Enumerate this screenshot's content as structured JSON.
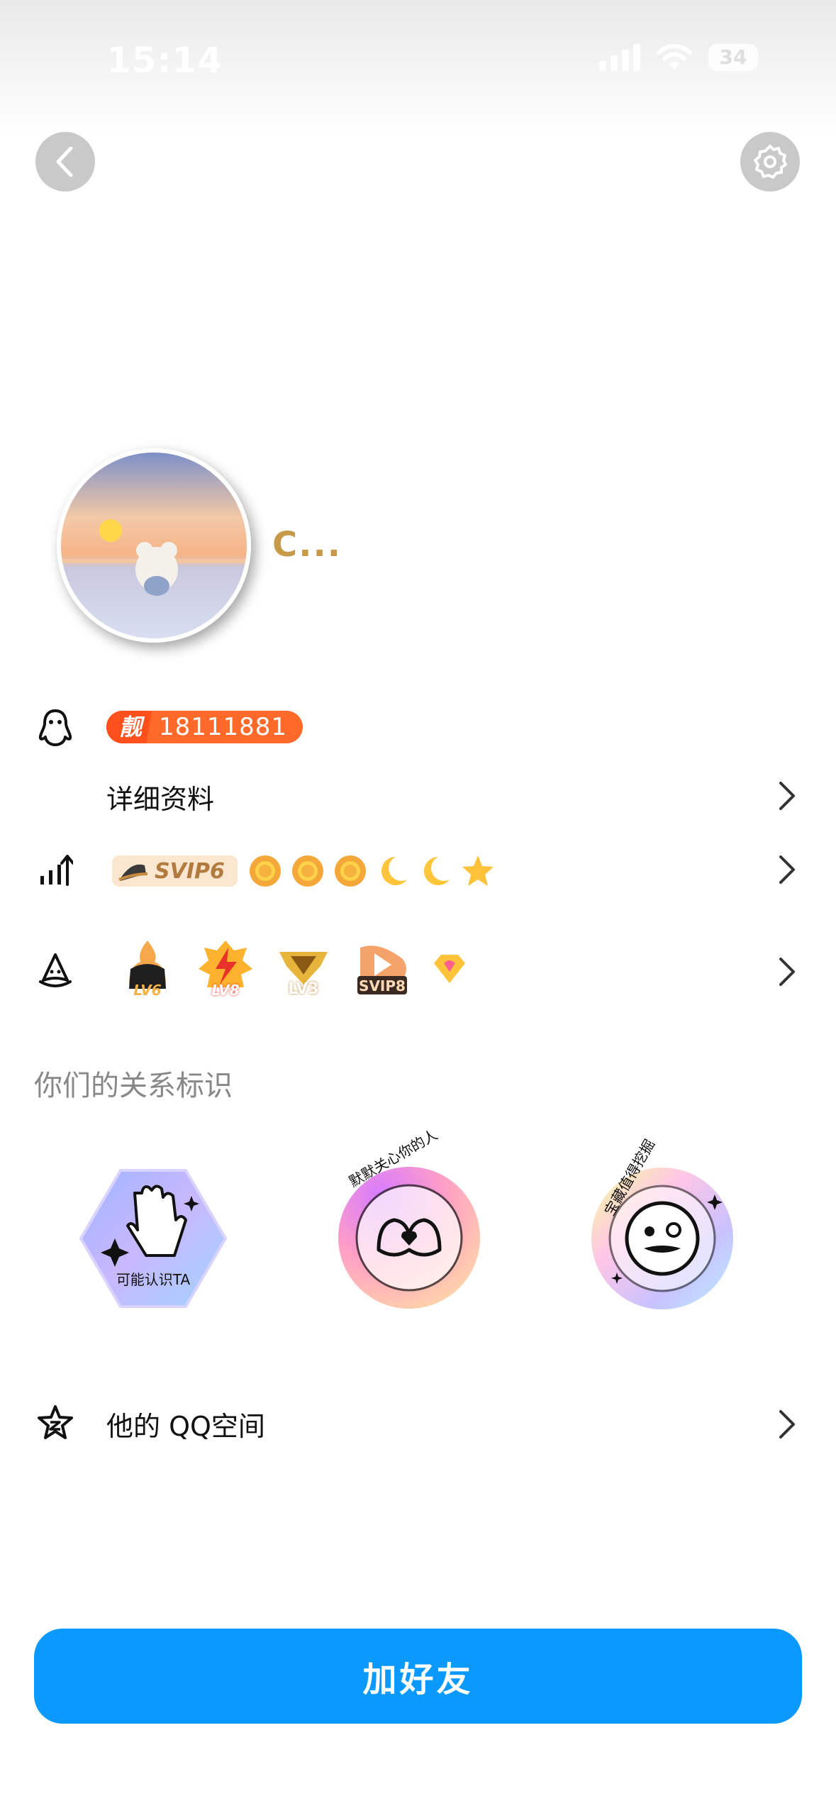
{
  "status_bar": {
    "time": "15:14",
    "battery": "34"
  },
  "profile": {
    "nickname": "C...",
    "qq_badge_label": "靓",
    "qq_number": "18111881"
  },
  "rows": {
    "detail_label": "详细资料",
    "svip_label": "SVIP6",
    "level_icons": [
      "sun-icon",
      "sun-icon",
      "sun-icon",
      "moon-icon",
      "moon-icon",
      "star-icon"
    ],
    "badges": [
      {
        "name": "badge-lv6",
        "text": "LV6"
      },
      {
        "name": "badge-lv8",
        "text": "LV8"
      },
      {
        "name": "badge-lv3",
        "text": "LV3"
      },
      {
        "name": "badge-svip8",
        "text": "SVIP8"
      }
    ]
  },
  "relations": {
    "title": "你们的关系标识",
    "items": [
      {
        "name": "relation-maybe-know",
        "text": "可能认识TA"
      },
      {
        "name": "relation-care",
        "text": "默默关心你的人"
      },
      {
        "name": "relation-treasure",
        "text": "宝藏值得挖掘"
      }
    ]
  },
  "qzone": {
    "label": "他的 QQ空间"
  },
  "add_button": {
    "label": "加好友"
  },
  "colors": {
    "accent": "#0a99ff",
    "nickname": "#c79a4a",
    "qq_badge": "#ff6a2a"
  }
}
